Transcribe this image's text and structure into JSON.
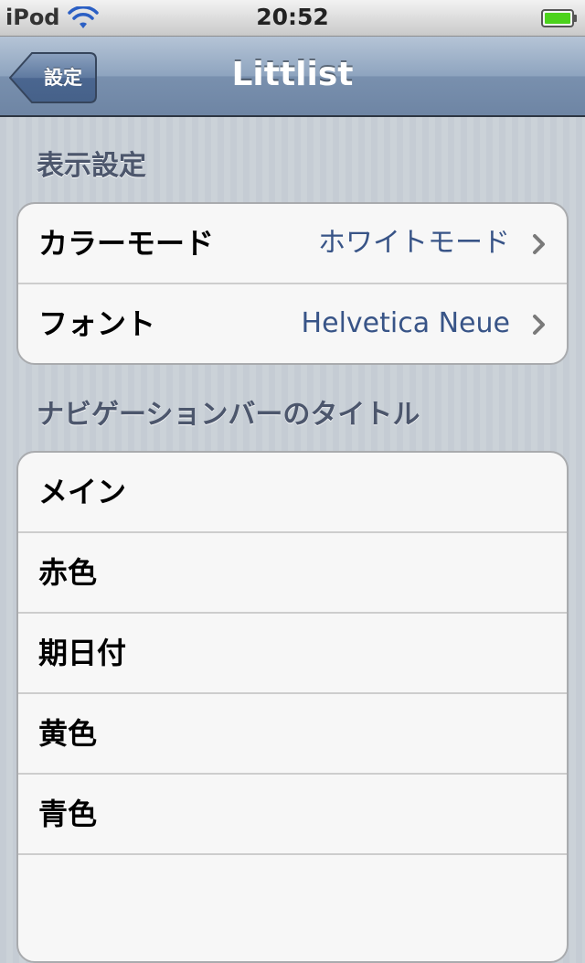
{
  "status_bar": {
    "carrier": "iPod",
    "time": "20:52",
    "icons": [
      "wifi-icon",
      "battery-icon"
    ],
    "battery_color": "#4cd21c"
  },
  "nav_bar": {
    "back_label": "設定",
    "title": "Littlist"
  },
  "sections": [
    {
      "header": "表示設定",
      "rows": [
        {
          "label": "カラーモード",
          "value": "ホワイトモード",
          "accessory": "chevron-icon"
        },
        {
          "label": "フォント",
          "value": "Helvetica Neue",
          "accessory": "chevron-icon"
        }
      ]
    },
    {
      "header": "ナビゲーションバーのタイトル",
      "rows": [
        {
          "label": "メイン"
        },
        {
          "label": "赤色"
        },
        {
          "label": "期日付"
        },
        {
          "label": "黄色"
        },
        {
          "label": "青色"
        },
        {
          "label": ""
        }
      ]
    }
  ],
  "colors": {
    "nav_bar": "#8ea4bf",
    "value_text": "#385487",
    "section_header": "#4c566c",
    "background": "#c5ccd4"
  }
}
